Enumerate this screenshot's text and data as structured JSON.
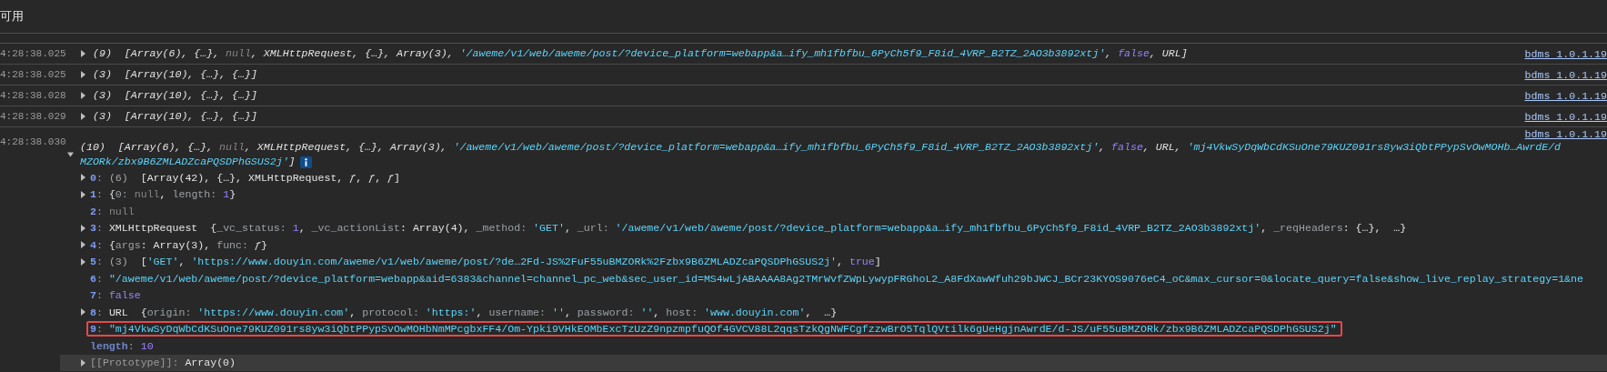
{
  "header": {
    "label": "可用"
  },
  "log": [
    {
      "time": "4:28:38.025",
      "expanded": false,
      "source": "bdms 1.0.1.19",
      "message": [
        [
          {
            "text": "(9)  [Array(6), {…}, ",
            "kind": "plain"
          },
          {
            "text": "null",
            "kind": "null"
          },
          {
            "text": ", XMLHttpRequest, {…}, Array(3), ",
            "kind": "plain"
          },
          {
            "text": "'/aweme/v1/web/aweme/post/?device_platform=webapp&a…ify_mh1fbfbu_6PyCh5f9_F8id_4VRP_B2TZ_2AO3b3892xtj'",
            "kind": "string"
          },
          {
            "text": ", ",
            "kind": "plain"
          },
          {
            "text": "false",
            "kind": "bool"
          },
          {
            "text": ", URL]",
            "kind": "plain"
          }
        ]
      ]
    },
    {
      "time": "4:28:38.025",
      "expanded": false,
      "source": "bdms 1.0.1.19",
      "message": [
        [
          {
            "text": "(3)  [Array(10), {…}, {…}]",
            "kind": "plain"
          }
        ]
      ]
    },
    {
      "time": "4:28:38.028",
      "expanded": false,
      "source": "bdms 1.0.1.19",
      "message": [
        [
          {
            "text": "(3)  [Array(10), {…}, {…}]",
            "kind": "plain"
          }
        ]
      ]
    },
    {
      "time": "4:28:38.029",
      "expanded": false,
      "source": "bdms 1.0.1.19",
      "message": [
        [
          {
            "text": "(3)  [Array(10), {…}, {…}]",
            "kind": "plain"
          }
        ]
      ]
    },
    {
      "time": "4:28:38.030",
      "expanded": true,
      "source": "bdms 1.0.1.19",
      "message": [
        [
          {
            "text": "(10)  [Array(6), {…}, ",
            "kind": "plain"
          },
          {
            "text": "null",
            "kind": "null"
          },
          {
            "text": ", XMLHttpRequest, {…}, Array(3), ",
            "kind": "plain"
          },
          {
            "text": "'/aweme/v1/web/aweme/post/?device_platform=webapp&a…ify_mh1fbfbu_6PyCh5f9_F8id_4VRP_B2TZ_2AO3b3892xtj'",
            "kind": "string"
          },
          {
            "text": ", ",
            "kind": "plain"
          },
          {
            "text": "false",
            "kind": "bool"
          },
          {
            "text": ", URL, ",
            "kind": "plain"
          },
          {
            "text": "'mj4VkwSyDqWbCdKSuOne79KUZ091rs8yw3iQbtPPypSvOwMOHb…AwrdE/d",
            "kind": "string"
          }
        ],
        [
          {
            "text": "MZORk/zbx9B6ZMLADZcaPQSDPhGSUS2j'",
            "kind": "string"
          },
          {
            "text": "]",
            "kind": "plain"
          }
        ]
      ],
      "entries": [
        {
          "label": "0",
          "kind": "index",
          "expandable": true,
          "selected": false,
          "annotated": false,
          "value": [
            {
              "text": ": ",
              "kind": "punct"
            },
            {
              "text": "(6)  ",
              "kind": "dim"
            },
            {
              "text": "[Array(42), {…}, XMLHttpRequest, ",
              "kind": "plain"
            },
            {
              "text": "ƒ",
              "kind": "fn"
            },
            {
              "text": ", ",
              "kind": "plain"
            },
            {
              "text": "ƒ",
              "kind": "fn"
            },
            {
              "text": ", ",
              "kind": "plain"
            },
            {
              "text": "ƒ",
              "kind": "fn"
            },
            {
              "text": "]",
              "kind": "plain"
            }
          ]
        },
        {
          "label": "1",
          "kind": "index",
          "expandable": true,
          "selected": false,
          "annotated": false,
          "value": [
            {
              "text": ": ",
              "kind": "punct"
            },
            {
              "text": "{",
              "kind": "plain"
            },
            {
              "text": "0",
              "kind": "key"
            },
            {
              "text": ": ",
              "kind": "punct"
            },
            {
              "text": "null",
              "kind": "null"
            },
            {
              "text": ", ",
              "kind": "plain"
            },
            {
              "text": "length",
              "kind": "key"
            },
            {
              "text": ": ",
              "kind": "punct"
            },
            {
              "text": "1",
              "kind": "number"
            },
            {
              "text": "}",
              "kind": "plain"
            }
          ]
        },
        {
          "label": "2",
          "kind": "index",
          "expandable": false,
          "selected": false,
          "annotated": false,
          "value": [
            {
              "text": ": ",
              "kind": "punct"
            },
            {
              "text": "null",
              "kind": "null"
            }
          ]
        },
        {
          "label": "3",
          "kind": "index",
          "expandable": true,
          "selected": false,
          "annotated": false,
          "value": [
            {
              "text": ": ",
              "kind": "punct"
            },
            {
              "text": "XMLHttpRequest  {",
              "kind": "plain"
            },
            {
              "text": "_vc_status",
              "kind": "key"
            },
            {
              "text": ": ",
              "kind": "punct"
            },
            {
              "text": "1",
              "kind": "number"
            },
            {
              "text": ", ",
              "kind": "plain"
            },
            {
              "text": "_vc_actionList",
              "kind": "key"
            },
            {
              "text": ": Array(4), ",
              "kind": "plain"
            },
            {
              "text": "_method",
              "kind": "key"
            },
            {
              "text": ": ",
              "kind": "punct"
            },
            {
              "text": "'GET'",
              "kind": "string"
            },
            {
              "text": ", ",
              "kind": "plain"
            },
            {
              "text": "_url",
              "kind": "key"
            },
            {
              "text": ": ",
              "kind": "punct"
            },
            {
              "text": "'/aweme/v1/web/aweme/post/?device_platform=webapp&a…ify_mh1fbfbu_6PyCh5f9_F8id_4VRP_B2TZ_2AO3b3892xtj'",
              "kind": "string"
            },
            {
              "text": ", ",
              "kind": "plain"
            },
            {
              "text": "_reqHeaders",
              "kind": "key"
            },
            {
              "text": ": {…},  …}",
              "kind": "plain"
            }
          ]
        },
        {
          "label": "4",
          "kind": "index",
          "expandable": true,
          "selected": false,
          "annotated": false,
          "value": [
            {
              "text": ": ",
              "kind": "punct"
            },
            {
              "text": "{",
              "kind": "plain"
            },
            {
              "text": "args",
              "kind": "key"
            },
            {
              "text": ": Array(3), ",
              "kind": "plain"
            },
            {
              "text": "func",
              "kind": "key"
            },
            {
              "text": ": ",
              "kind": "punct"
            },
            {
              "text": "ƒ",
              "kind": "fn"
            },
            {
              "text": "}",
              "kind": "plain"
            }
          ]
        },
        {
          "label": "5",
          "kind": "index",
          "expandable": true,
          "selected": false,
          "annotated": false,
          "value": [
            {
              "text": ": ",
              "kind": "punct"
            },
            {
              "text": "(3)  ",
              "kind": "dim"
            },
            {
              "text": "[",
              "kind": "plain"
            },
            {
              "text": "'GET'",
              "kind": "string"
            },
            {
              "text": ", ",
              "kind": "plain"
            },
            {
              "text": "'https://www.douyin.com/aweme/v1/web/aweme/post/?de…2Fd-JS%2FuF55uBMZORk%2Fzbx9B6ZMLADZcaPQSDPhGSUS2j'",
              "kind": "string"
            },
            {
              "text": ", ",
              "kind": "plain"
            },
            {
              "text": "true",
              "kind": "bool"
            },
            {
              "text": "]",
              "kind": "plain"
            }
          ]
        },
        {
          "label": "6",
          "kind": "index",
          "expandable": false,
          "selected": false,
          "annotated": false,
          "value": [
            {
              "text": ": ",
              "kind": "punct"
            },
            {
              "text": "\"/aweme/v1/web/aweme/post/?device_platform=webapp&aid=6383&channel=channel_pc_web&sec_user_id=MS4wLjABAAAA8Ag2TMrWvfZWpLywypFRGhoL2_A8FdXawWfuh29bJWCJ_BCr23KYOS9076eC4_oC&max_cursor=0&locate_query=false&show_live_replay_strategy=1&ne",
              "kind": "string"
            }
          ]
        },
        {
          "label": "7",
          "kind": "index",
          "expandable": false,
          "selected": false,
          "annotated": false,
          "value": [
            {
              "text": ": ",
              "kind": "punct"
            },
            {
              "text": "false",
              "kind": "bool"
            }
          ]
        },
        {
          "label": "8",
          "kind": "index",
          "expandable": true,
          "selected": false,
          "annotated": false,
          "value": [
            {
              "text": ": ",
              "kind": "punct"
            },
            {
              "text": "URL  {",
              "kind": "plain"
            },
            {
              "text": "origin",
              "kind": "key"
            },
            {
              "text": ": ",
              "kind": "punct"
            },
            {
              "text": "'https://www.douyin.com'",
              "kind": "string"
            },
            {
              "text": ", ",
              "kind": "plain"
            },
            {
              "text": "protocol",
              "kind": "key"
            },
            {
              "text": ": ",
              "kind": "punct"
            },
            {
              "text": "'https:'",
              "kind": "string"
            },
            {
              "text": ", ",
              "kind": "plain"
            },
            {
              "text": "username",
              "kind": "key"
            },
            {
              "text": ": ",
              "kind": "punct"
            },
            {
              "text": "''",
              "kind": "string"
            },
            {
              "text": ", ",
              "kind": "plain"
            },
            {
              "text": "password",
              "kind": "key"
            },
            {
              "text": ": ",
              "kind": "punct"
            },
            {
              "text": "''",
              "kind": "string"
            },
            {
              "text": ", ",
              "kind": "plain"
            },
            {
              "text": "host",
              "kind": "key"
            },
            {
              "text": ": ",
              "kind": "punct"
            },
            {
              "text": "'www.douyin.com'",
              "kind": "string"
            },
            {
              "text": ",  …}",
              "kind": "plain"
            }
          ]
        },
        {
          "label": "9",
          "kind": "index",
          "expandable": false,
          "selected": false,
          "annotated": true,
          "value": [
            {
              "text": ": ",
              "kind": "punct"
            },
            {
              "text": "\"mj4VkwSyDqWbCdKSuOne79KUZ091rs8yw3iQbtPPypSvOwMOHbNmMPcgbxFF4/Om-Ypki9VHkEOMbExcTzUzZ9npzmpfuQOf4GVCV88L2qqsTzkQgNWFCgfzzwBrO5TqlQVtilk6gUeHgjnAwrdE/d-JS/uF55uBMZORk/zbx9B6ZMLADZcaPQSDPhGSUS2j\"",
              "kind": "string"
            }
          ]
        },
        {
          "label": "length",
          "kind": "meta",
          "expandable": false,
          "selected": false,
          "annotated": false,
          "value": [
            {
              "text": ": ",
              "kind": "punct"
            },
            {
              "text": "10",
              "kind": "number"
            }
          ]
        },
        {
          "label": "[[Prototype]]",
          "kind": "internal",
          "expandable": true,
          "selected": true,
          "annotated": false,
          "value": [
            {
              "text": ": ",
              "kind": "punct"
            },
            {
              "text": "Array(0)",
              "kind": "plain"
            }
          ]
        }
      ]
    }
  ]
}
